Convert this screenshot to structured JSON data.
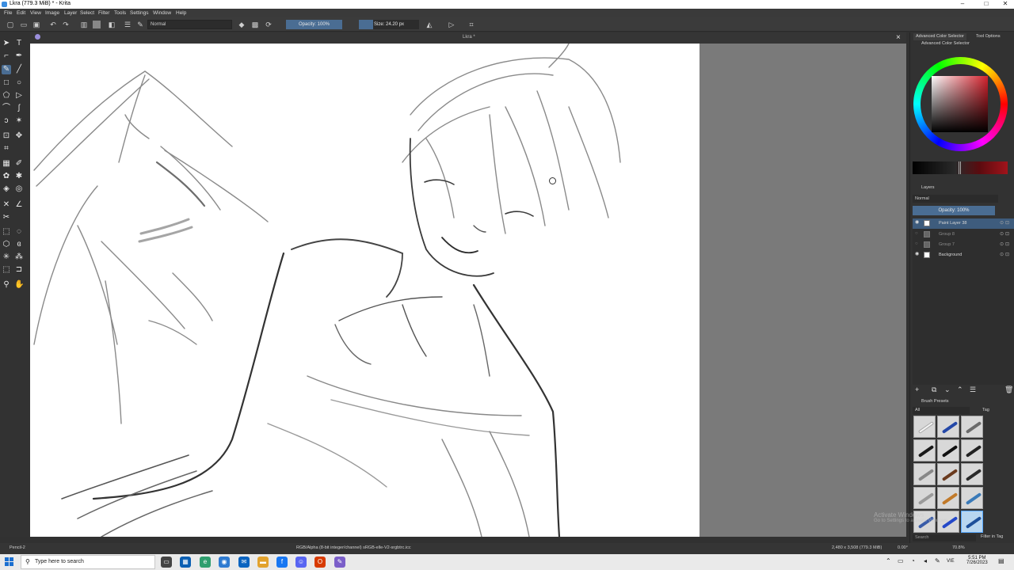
{
  "window": {
    "title": "Lkra (779.3 MiB)  * - Krita",
    "controls": [
      "–",
      "□",
      "✕"
    ]
  },
  "menu": [
    "File",
    "Edit",
    "View",
    "Image",
    "Layer",
    "Select",
    "Filter",
    "Tools",
    "Settings",
    "Window",
    "Help"
  ],
  "toolbar": {
    "blend_mode": "Normal",
    "opacity": "Opacity: 100%",
    "size": "Size: 24.20 px"
  },
  "document": {
    "tab_label": "Lkra *"
  },
  "dock": {
    "tabs": [
      "Advanced Color Selector",
      "Tool Options"
    ],
    "color_selector_title": "Advanced Color Selector",
    "layers_title": "Layers",
    "layers_blend": "Normal",
    "layers_opacity": "Opacity: 100%",
    "layers": [
      {
        "name": "Paint Layer 38",
        "active": true
      },
      {
        "name": "Group 8",
        "active": false
      },
      {
        "name": "Group 7",
        "active": false
      },
      {
        "name": "Background",
        "active": false
      }
    ],
    "brush_presets_title": "Brush Presets",
    "brush_tag": "All",
    "brush_tag_label": "Tag",
    "brush_search_placeholder": "Search",
    "filter_in_tag": "Filter in Tag",
    "watermark": "Activate Windows",
    "watermark_sub": "Go to Settings to activate Windows."
  },
  "status": {
    "brush": "Pencil-2",
    "color_info": "RGB/Alpha (8-bit integer/channel)  sRGB-elle-V2-srgbtrc.icc",
    "dimensions": "2,480 x 3,508 (779.3 MiB)",
    "rotation": "0.00°",
    "zoom": "70.8%"
  },
  "taskbar": {
    "search_placeholder": "Type here to search",
    "time": "5:51 PM",
    "date": "7/26/2023",
    "lang": "VIE"
  }
}
